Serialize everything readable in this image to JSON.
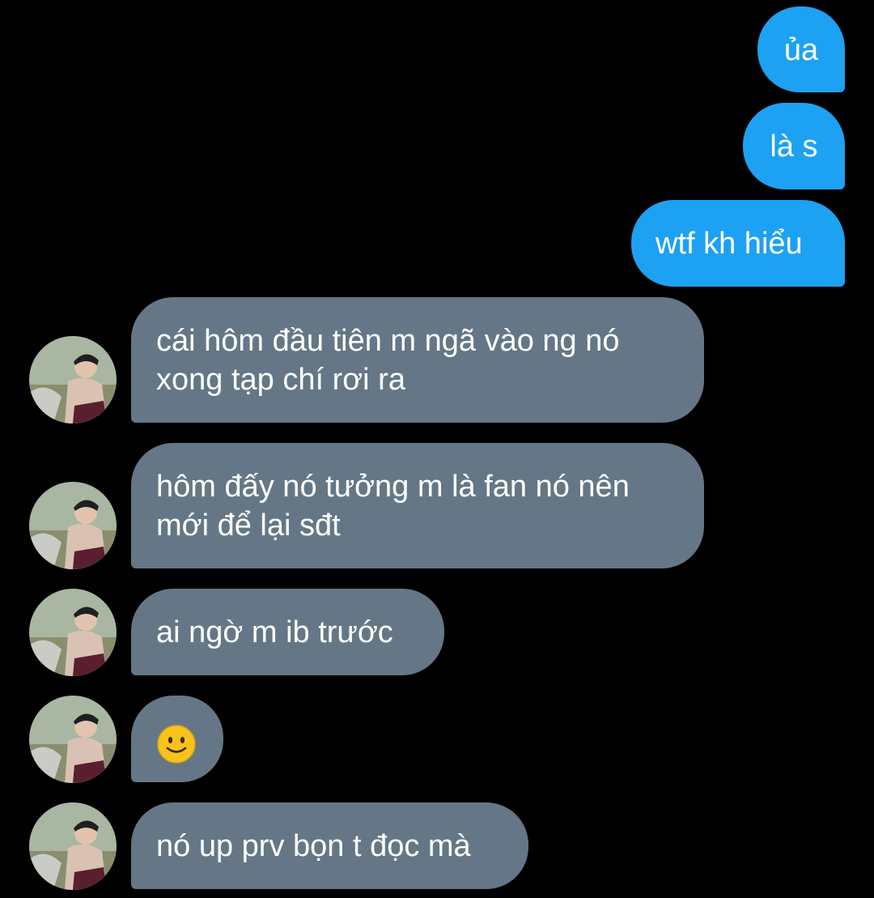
{
  "messages": [
    {
      "direction": "outgoing",
      "text": "ủa"
    },
    {
      "direction": "outgoing",
      "text": "là s"
    },
    {
      "direction": "outgoing",
      "text": "wtf kh hiểu"
    },
    {
      "direction": "incoming",
      "lines": [
        "cái hôm đầu tiên m ngã vào ng nó",
        "xong tạp chí rơi ra"
      ]
    },
    {
      "direction": "incoming",
      "lines": [
        "hôm đấy nó tưởng m là fan nó nên",
        "mới để lại sđt"
      ]
    },
    {
      "direction": "incoming",
      "text": "ai ngờ m ib trước"
    },
    {
      "direction": "incoming",
      "emoji": "slightly-smiling-face"
    },
    {
      "direction": "incoming",
      "text": "nó up prv bọn t đọc mà"
    }
  ],
  "colors": {
    "background": "#000000",
    "outgoing_bubble": "#1da1f2",
    "incoming_bubble": "#657786",
    "text": "#ffffff",
    "emoji_face": "#f7c21b"
  },
  "avatar": {
    "icon": "user-avatar-photo"
  }
}
